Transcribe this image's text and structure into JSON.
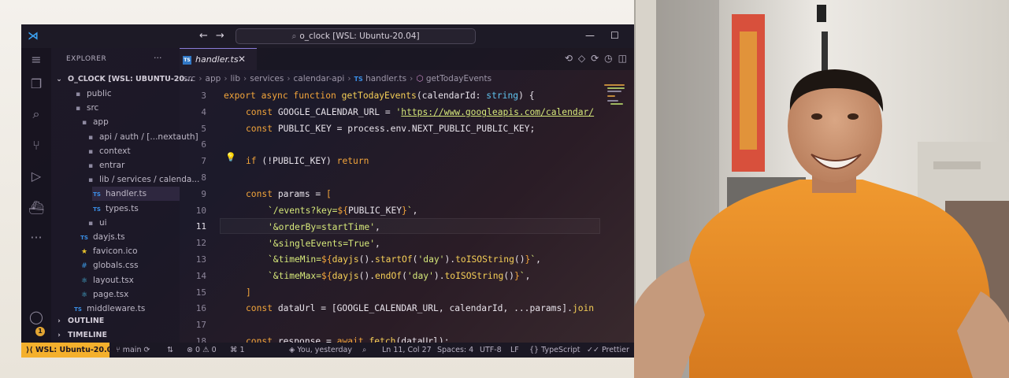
{
  "window": {
    "title": "o_clock [WSL: Ubuntu-20.04]",
    "minimize_label": "—",
    "maximize_label": "☐"
  },
  "explorer": {
    "header": "EXPLORER",
    "more_label": "···",
    "root_label": "O_CLOCK [WSL: UBUNTU-20...",
    "items": [
      {
        "label": "public",
        "icon": "folder-icon"
      },
      {
        "label": "src",
        "icon": "folder-icon"
      },
      {
        "label": "app",
        "icon": "folder-icon"
      },
      {
        "label": "api / auth / [...nextauth]",
        "icon": "folder-icon"
      },
      {
        "label": "context",
        "icon": "folder-icon"
      },
      {
        "label": "entrar",
        "icon": "folder-icon"
      },
      {
        "label": "lib / services / calenda...",
        "icon": "folder-icon"
      },
      {
        "label": "handler.ts",
        "icon": "typescript-file-icon",
        "selected": true
      },
      {
        "label": "types.ts",
        "icon": "typescript-file-icon"
      },
      {
        "label": "ui",
        "icon": "folder-icon"
      },
      {
        "label": "dayjs.ts",
        "icon": "typescript-file-icon"
      },
      {
        "label": "favicon.ico",
        "icon": "star-icon"
      },
      {
        "label": "globals.css",
        "icon": "css-file-icon"
      },
      {
        "label": "layout.tsx",
        "icon": "react-file-icon"
      },
      {
        "label": "page.tsx",
        "icon": "react-file-icon"
      },
      {
        "label": "middleware.ts",
        "icon": "typescript-file-icon"
      }
    ],
    "outline_label": "OUTLINE",
    "timeline_label": "TIMELINE"
  },
  "tab": {
    "badge": "TS",
    "label": "handler.ts",
    "close": "✕"
  },
  "breadcrumb": [
    "src",
    "app",
    "lib",
    "services",
    "calendar-api",
    "handler.ts",
    "getTodayEvents"
  ],
  "editor": {
    "line_numbers": [
      "3",
      "4",
      "5",
      "6",
      "7",
      "8",
      "9",
      "10",
      "11",
      "12",
      "13",
      "14",
      "15",
      "16",
      "17",
      "18"
    ],
    "active_line": "11"
  },
  "status": {
    "remote": "WSL: Ubuntu-20.04",
    "branch": "main",
    "problems": "0",
    "warnings": "0",
    "ports": "1",
    "blame": "You, yesterday",
    "cursor": "Ln 11, Col 27",
    "spaces": "Spaces: 4",
    "encoding": "UTF-8",
    "eol": "LF",
    "language": "TypeScript",
    "formatter": "Prettier"
  },
  "colors": {
    "accent": "#f4b02d",
    "keyword": "#f3a53b",
    "function": "#f6cf57",
    "string": "#d6e87a",
    "type": "#60c4f0",
    "shirt": "#e7912f"
  }
}
